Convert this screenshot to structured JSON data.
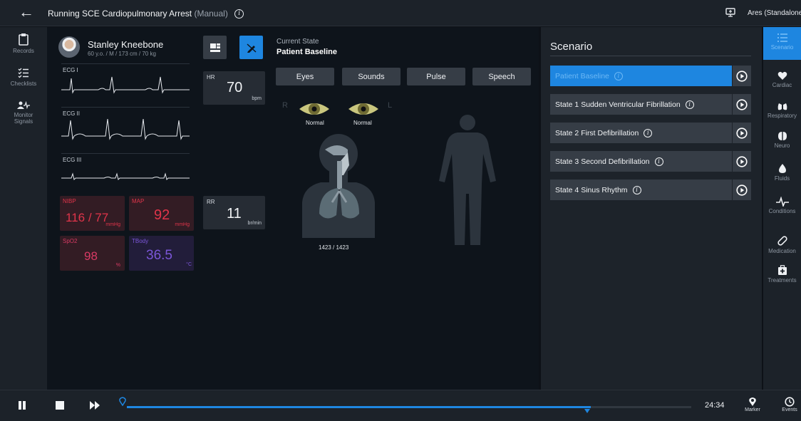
{
  "header": {
    "title_prefix": "Running SCE",
    "scenario_name": "Cardiopulmonary Arrest",
    "mode": "(Manual)",
    "instance": "Ares (Standalone)"
  },
  "left_nav": [
    {
      "label": "Records",
      "icon": "clipboard-icon"
    },
    {
      "label": "Checklists",
      "icon": "checklist-icon"
    },
    {
      "label": "Monitor Signals",
      "icon": "person-pulse-icon"
    }
  ],
  "patient": {
    "name": "Stanley Kneebone",
    "details": "60 y.o. / M / 173 cm / 70 kg"
  },
  "current_state": {
    "label": "Current State",
    "value": "Patient Baseline"
  },
  "ecg": [
    {
      "label": "ECG I"
    },
    {
      "label": "ECG II"
    },
    {
      "label": "ECG III"
    }
  ],
  "vitals": {
    "nibp": {
      "label": "NIBP",
      "value": "116 / 77",
      "unit": "mmHg"
    },
    "map": {
      "label": "MAP",
      "value": "92",
      "unit": "mmHg"
    },
    "spo2": {
      "label": "SpO2",
      "value": "98",
      "unit": "%"
    },
    "tbody": {
      "label": "TBody",
      "value": "36.5",
      "unit": "°C"
    },
    "hr": {
      "label": "HR",
      "value": "70",
      "unit": "bpm"
    },
    "rr": {
      "label": "RR",
      "value": "11",
      "unit": "br/min"
    }
  },
  "tabs": [
    "Eyes",
    "Sounds",
    "Pulse",
    "Speech"
  ],
  "eyes": {
    "right_label": "R",
    "left_label": "L",
    "right_state": "Normal",
    "left_state": "Normal"
  },
  "respiration_count": "1423 / 1423",
  "scenario": {
    "title": "Scenario",
    "states": [
      {
        "label": "Patient Baseline",
        "active": true
      },
      {
        "label": "State 1 Sudden Ventricular Fibrillation",
        "active": false
      },
      {
        "label": "State 2 First Defibrillation",
        "active": false
      },
      {
        "label": "State 3 Second Defibrillation",
        "active": false
      },
      {
        "label": "State 4 Sinus Rhythm",
        "active": false
      }
    ]
  },
  "right_nav": [
    {
      "label": "Scenario",
      "icon": "list-icon",
      "active": true
    },
    {
      "label": "Cardiac",
      "icon": "heart-icon"
    },
    {
      "label": "Respiratory",
      "icon": "lungs-icon"
    },
    {
      "label": "Neuro",
      "icon": "brain-icon"
    },
    {
      "label": "Fluids",
      "icon": "drop-icon"
    },
    {
      "label": "Conditions",
      "icon": "pulse-icon"
    },
    {
      "label": "Medication",
      "icon": "pill-icon"
    },
    {
      "label": "Treatments",
      "icon": "first-aid-icon"
    }
  ],
  "timeline": {
    "time": "24:34",
    "progress": 0.822,
    "marker_label": "Marker",
    "events_label": "Events"
  },
  "colors": {
    "accent": "#1e86e0",
    "nibp": "#e0344a",
    "spo2": "#d83a64",
    "tbody": "#7b56d8"
  }
}
